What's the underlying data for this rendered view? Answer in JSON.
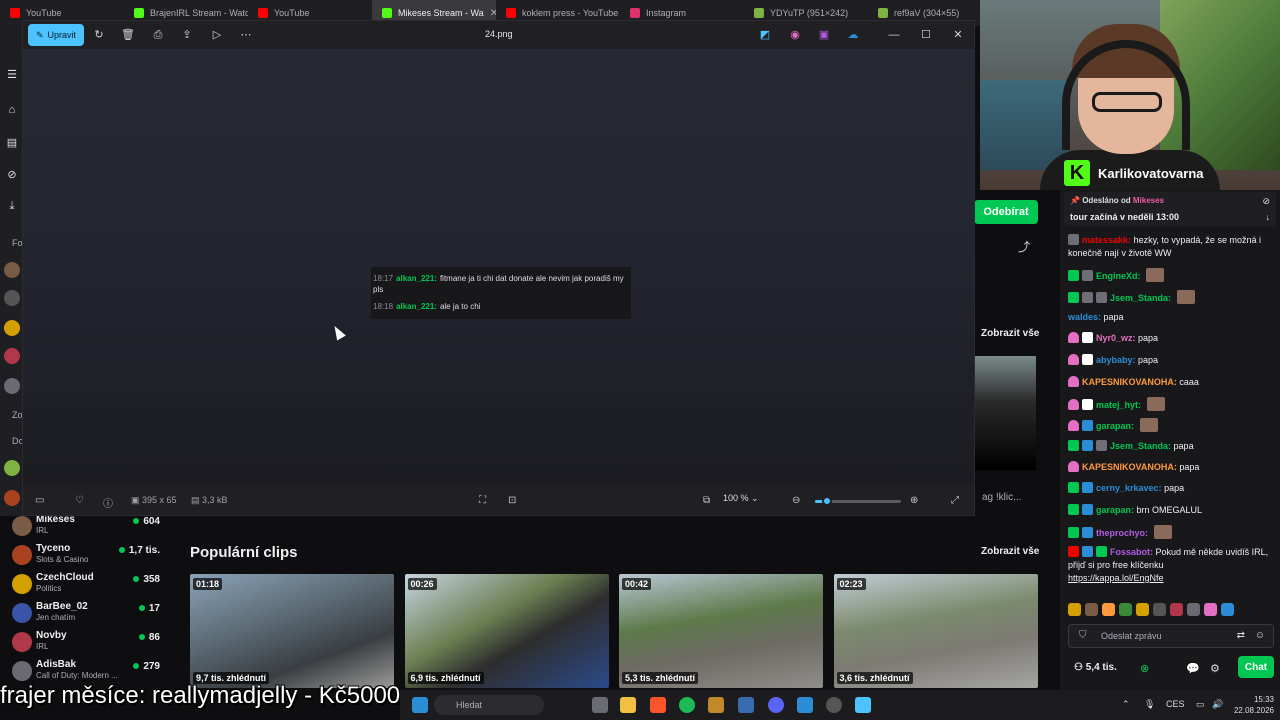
{
  "browser_tabs": [
    {
      "label": "YouTube",
      "color": "#ff0000"
    },
    {
      "label": "BrajenIRL Stream - Watch",
      "color": "#53fc18"
    },
    {
      "label": "YouTube",
      "color": "#ff0000"
    },
    {
      "label": "Mikeses Stream - Wa",
      "color": "#53fc18",
      "active": true
    },
    {
      "label": "koklem press - YouTube",
      "color": "#ff0000"
    },
    {
      "label": "Instagram",
      "color": "#e1306c"
    },
    {
      "label": "YDYuTP (951×242)",
      "color": "#7cb342"
    },
    {
      "label": "ref9aV (304×55)",
      "color": "#7cb342"
    }
  ],
  "sidebar": {
    "labels": {
      "follow": "Fo",
      "zo": "Zo",
      "do": "Do"
    }
  },
  "viewer": {
    "edit_label": "Upravit",
    "file_title": "24.png",
    "image_size": "395 x 65",
    "file_size": "3,3 kB",
    "zoom": "100 %",
    "zoom_level": 0.14,
    "screenshot_lines": [
      {
        "time": "18:17",
        "user": "alkan_221:",
        "text": "fitmane ja ti chi dat donate ale nevim jak poradiš my pls"
      },
      {
        "time": "18:18",
        "user": "alkan_221:",
        "text": "ale ja to chi"
      }
    ]
  },
  "streamer": {
    "name": "Karlikovatovarna",
    "follow_label": "Odebírat",
    "show_all_label": "Zobrazit vše",
    "side_bottom": "ag !klic..."
  },
  "channels": [
    {
      "name": "Mikeses",
      "category": "IRL",
      "viewers": "604",
      "color": "#7a5c46"
    },
    {
      "name": "Tyceno",
      "category": "Slots & Casino",
      "viewers": "1,7 tis.",
      "color": "#a8421f"
    },
    {
      "name": "CzechCloud",
      "category": "Politics",
      "viewers": "358",
      "color": "#d4a000"
    },
    {
      "name": "BarBee_02",
      "category": "Jen chatím",
      "viewers": "17",
      "color": "#3954a8"
    },
    {
      "name": "Novby",
      "category": "IRL",
      "viewers": "86",
      "color": "#b0384a"
    },
    {
      "name": "AdisBak",
      "category": "Call of Duty: Modern ...",
      "viewers": "279",
      "color": "#6a6a72"
    }
  ],
  "clips": {
    "heading": "Populární clips",
    "show_all_label": "Zobrazit vše",
    "items": [
      {
        "duration": "01:18",
        "views": "9,7 tis. zhlédnutí"
      },
      {
        "duration": "00:26",
        "views": "6,9 tis. zhlédnutí"
      },
      {
        "duration": "00:42",
        "views": "5,3 tis. zhlédnutí"
      },
      {
        "duration": "02:23",
        "views": "3,6 tis. zhlédnutí"
      }
    ]
  },
  "chat": {
    "pinned_from_label": "Odesláno od",
    "pinned_from_user": "Mikeses",
    "pinned_message": "tour začíná v neděli 13:00",
    "messages": [
      {
        "user": "matessakk:",
        "text": "hezky, to vypadá, že se možná i konečně nají v životě WW",
        "color": "#eb0400"
      },
      {
        "user": "EngineXd:",
        "text": "",
        "color": "#00c853"
      },
      {
        "user": "Jsem_Standa:",
        "text": "",
        "color": "#00c853"
      },
      {
        "user": "waldes:",
        "text": "papa",
        "color": "#2b8dd6"
      },
      {
        "user": "Nyr0_wz:",
        "text": "papa",
        "color": "#e26fc1"
      },
      {
        "user": "abybaby:",
        "text": "papa",
        "color": "#2b8dd6"
      },
      {
        "user": "KAPESNIKOVANOHA:",
        "text": "caaa",
        "color": "#ff9a3c"
      },
      {
        "user": "matej_hyt:",
        "text": "",
        "color": "#00c853"
      },
      {
        "user": "garapan:",
        "text": "",
        "color": "#00c853"
      },
      {
        "user": "Jsem_Standa:",
        "text": "papa",
        "color": "#00c853"
      },
      {
        "user": "KAPESNIKOVANOHA:",
        "text": "papa",
        "color": "#ff9a3c"
      },
      {
        "user": "cerny_krkavec:",
        "text": "papa",
        "color": "#2b8dd6"
      },
      {
        "user": "garapan:",
        "text": "brn OMEGALUL",
        "color": "#00c853"
      },
      {
        "user": "theprochyo:",
        "text": "",
        "color": "#b05be0"
      },
      {
        "user": "Fossabot:",
        "text": "Pokud mě někde uvidíš IRL, přijď si pro free klíčenku",
        "link": "https://kappa.lol/EngNfe",
        "color": "#b05be0"
      }
    ],
    "input_placeholder": "Odeslat zprávu",
    "points": "5,4 tis.",
    "chat_button": "Chat"
  },
  "overlay_text": "frajer měsíce: reallymadjelly - Kč5000",
  "taskbar": {
    "search_placeholder": "Hledat",
    "lang": "CES",
    "time": "15:33",
    "date": "22.08.2026"
  }
}
